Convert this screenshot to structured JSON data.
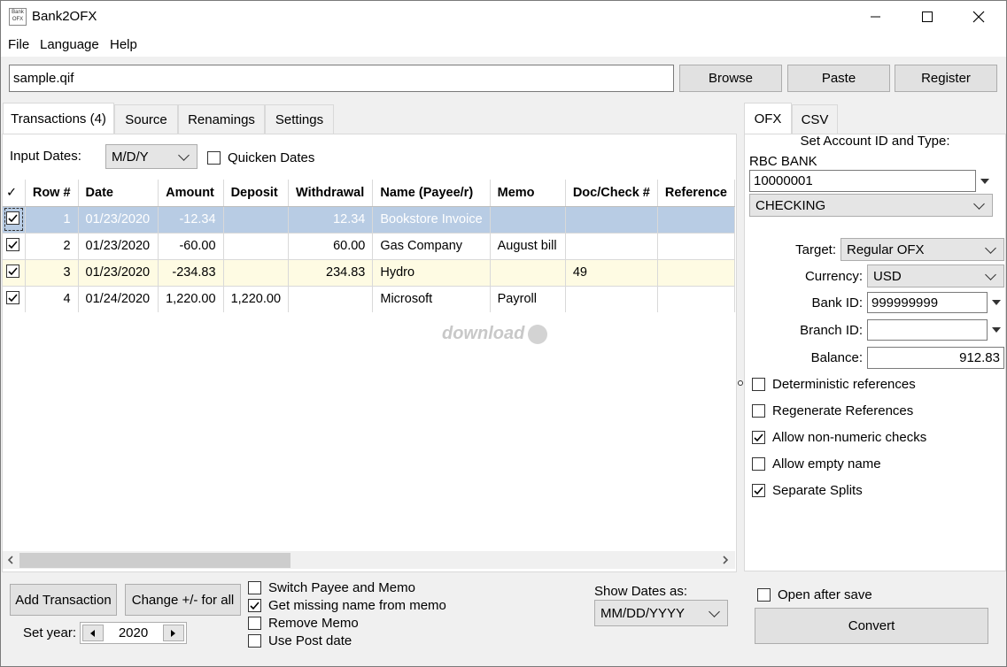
{
  "window": {
    "title": "Bank2OFX",
    "icon_text": "Bank OFX",
    "controls": [
      "minimize-icon",
      "maximize-icon",
      "close-icon"
    ]
  },
  "menu": [
    "File",
    "Language",
    "Help"
  ],
  "file_row": {
    "path": "sample.qif",
    "browse": "Browse",
    "paste": "Paste",
    "register": "Register"
  },
  "tabs": [
    "Transactions (4)",
    "Source",
    "Renamings",
    "Settings"
  ],
  "input_dates": {
    "label": "Input Dates:",
    "value": "M/D/Y",
    "quicken_label": "Quicken Dates",
    "quicken_checked": false
  },
  "grid": {
    "columns": [
      "✓",
      "Row #",
      "Date",
      "Amount",
      "Deposit",
      "Withdrawal",
      "Name (Payee/r)",
      "Memo",
      "Doc/Check #",
      "Reference"
    ],
    "rows": [
      {
        "checked": true,
        "row": "1",
        "date": "01/23/2020",
        "amount": "-12.34",
        "deposit": "",
        "withdrawal": "12.34",
        "name": "Bookstore Invoice",
        "memo": "",
        "doc": "",
        "reference": ""
      },
      {
        "checked": true,
        "row": "2",
        "date": "01/23/2020",
        "amount": "-60.00",
        "deposit": "",
        "withdrawal": "60.00",
        "name": "Gas Company",
        "memo": "August bill",
        "doc": "",
        "reference": ""
      },
      {
        "checked": true,
        "row": "3",
        "date": "01/23/2020",
        "amount": "-234.83",
        "deposit": "",
        "withdrawal": "234.83",
        "name": "Hydro",
        "memo": "",
        "doc": "49",
        "reference": ""
      },
      {
        "checked": true,
        "row": "4",
        "date": "01/24/2020",
        "amount": "1,220.00",
        "deposit": "1,220.00",
        "withdrawal": "",
        "name": "Microsoft",
        "memo": "Payroll",
        "doc": "",
        "reference": ""
      }
    ],
    "watermark": "download"
  },
  "bottom": {
    "add_transaction": "Add Transaction",
    "change_sign": "Change +/- for all",
    "set_year_label": "Set year:",
    "year": "2020",
    "options": [
      {
        "label": "Switch Payee and Memo",
        "checked": false
      },
      {
        "label": "Get missing name from memo",
        "checked": true
      },
      {
        "label": "Remove Memo",
        "checked": false
      },
      {
        "label": "Use Post date",
        "checked": false
      }
    ],
    "show_dates_label": "Show Dates as:",
    "show_dates_value": "MM/DD/YYYY"
  },
  "right": {
    "tabs": [
      "OFX",
      "CSV"
    ],
    "set_account_label": "Set Account ID and Type:",
    "bank_name": "RBC BANK",
    "account_id": "10000001",
    "account_type": "CHECKING",
    "target_label": "Target:",
    "target_value": "Regular OFX",
    "currency_label": "Currency:",
    "currency_value": "USD",
    "bank_id_label": "Bank ID:",
    "bank_id_value": "999999999",
    "branch_id_label": "Branch ID:",
    "branch_id_value": "",
    "balance_label": "Balance:",
    "balance_value": "912.83",
    "options": [
      {
        "label": "Deterministic references",
        "checked": false
      },
      {
        "label": "Regenerate References",
        "checked": false
      },
      {
        "label": "Allow non-numeric checks",
        "checked": true
      },
      {
        "label": "Allow empty name",
        "checked": false
      },
      {
        "label": "Separate Splits",
        "checked": true
      }
    ],
    "open_after_save": "Open after save",
    "open_after_save_checked": false,
    "convert": "Convert"
  }
}
